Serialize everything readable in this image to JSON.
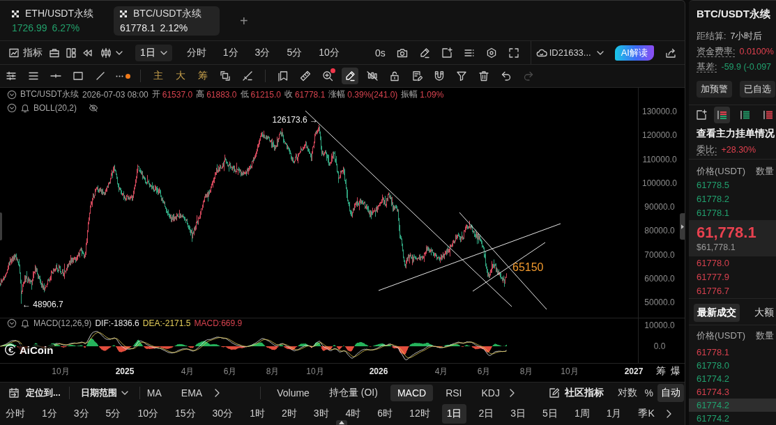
{
  "tabs": [
    {
      "symbol": "ETH/USDT永续",
      "price": "1726.99",
      "change": "6.27%",
      "selected": false
    },
    {
      "symbol": "BTC/USDT永续",
      "price": "61778.1",
      "change": "2.12%",
      "selected": true
    }
  ],
  "new_tab": "+",
  "toolbar": {
    "indicators": "指标",
    "interval": "1日",
    "quick_intervals": [
      "分时",
      "1分",
      "3分",
      "5分",
      "10分"
    ],
    "countdown": "0s",
    "account": "ID21633...",
    "ai_button": "AI解读"
  },
  "drawing_toolbar": {
    "modes": [
      "主",
      "大",
      "筹"
    ],
    "more_dot": true,
    "zoom_dot": true,
    "pen_selected": true,
    "redo_disabled": true
  },
  "chart": {
    "symbol": "BTC/USDT永续",
    "time": "2026-07-03 08:00",
    "quote": [
      {
        "label": "开",
        "value": "61537.0"
      },
      {
        "label": "高",
        "value": "61883.0"
      },
      {
        "label": "低",
        "value": "61215.0"
      },
      {
        "label": "收",
        "value": "61778.1"
      },
      {
        "label": "涨幅",
        "value": "0.39%(241.0)"
      },
      {
        "label": "振幅",
        "value": "1.09%"
      }
    ],
    "overlay": "BOLL(20,2)",
    "price_axis": [
      "130000.0",
      "120000.0",
      "110000.0",
      "100000.0",
      "90000.0",
      "80000.0",
      "70000.0",
      "60000.0",
      "50000.0"
    ],
    "high_marker": "126173.6 →",
    "low_marker": "← 48906.7",
    "level_label": "65150",
    "macd": {
      "name": "MACD(12,26,9)",
      "dif": "DIF:-1836.6",
      "dea": "DEA:-2171.5",
      "value": "MACD:669.9",
      "axis": [
        "10000.0",
        "0.0"
      ]
    },
    "logo": "AiCoin",
    "time_axis": [
      {
        "label": "10月",
        "kind": "month"
      },
      {
        "label": "2025",
        "kind": "year"
      },
      {
        "label": "4月",
        "kind": "month"
      },
      {
        "label": "6月",
        "kind": "month"
      },
      {
        "label": "8月",
        "kind": "month"
      },
      {
        "label": "10月",
        "kind": "month"
      },
      {
        "label": "2026",
        "kind": "year"
      },
      {
        "label": "4月",
        "kind": "month"
      },
      {
        "label": "6月",
        "kind": "month"
      },
      {
        "label": "8月",
        "kind": "month"
      },
      {
        "label": "10月",
        "kind": "month"
      },
      {
        "label": "2027",
        "kind": "year"
      }
    ],
    "axis_buttons": [
      "筹",
      "爆"
    ]
  },
  "indicator_bar": {
    "locate": "定位到...",
    "date_range": "日期范围",
    "main_indicators": [
      "MA",
      "EMA"
    ],
    "sub_indicators": [
      {
        "label": "Volume",
        "selected": false
      },
      {
        "label": "持仓量 (OI)",
        "selected": false
      },
      {
        "label": "MACD",
        "selected": true
      },
      {
        "label": "RSI",
        "selected": false
      },
      {
        "label": "KDJ",
        "selected": false
      }
    ],
    "community": "社区指标",
    "scale_options": [
      {
        "label": "对数",
        "selected": false
      },
      {
        "label": "%",
        "selected": false
      },
      {
        "label": "自动",
        "selected": true
      }
    ]
  },
  "periods": [
    {
      "label": "分时",
      "selected": false
    },
    {
      "label": "1分",
      "selected": false
    },
    {
      "label": "3分",
      "selected": false
    },
    {
      "label": "5分",
      "selected": false
    },
    {
      "label": "10分",
      "selected": false
    },
    {
      "label": "15分",
      "selected": false
    },
    {
      "label": "30分",
      "selected": false
    },
    {
      "label": "1时",
      "selected": false
    },
    {
      "label": "2时",
      "selected": false
    },
    {
      "label": "3时",
      "selected": false
    },
    {
      "label": "4时",
      "selected": false
    },
    {
      "label": "6时",
      "selected": false
    },
    {
      "label": "12时",
      "selected": false
    },
    {
      "label": "1日",
      "selected": true
    },
    {
      "label": "2日",
      "selected": false
    },
    {
      "label": "3日",
      "selected": false
    },
    {
      "label": "5日",
      "selected": false
    },
    {
      "label": "1周",
      "selected": false
    },
    {
      "label": "1月",
      "selected": false
    },
    {
      "label": "季K",
      "selected": false
    }
  ],
  "side_panel": {
    "symbol": "BTC/USDT永续",
    "stats": [
      {
        "label": "距结算:",
        "value": "7小时后",
        "color": "#cccccc",
        "tooltip": false
      },
      {
        "label": "资金费率:",
        "value": "0.0100%",
        "color": "#e0404e",
        "tooltip": true
      },
      {
        "label": "基差:",
        "value": "-59.9 (-0.097",
        "color": "#21a06e",
        "tooltip": true
      }
    ],
    "buttons": [
      "加预警",
      "已自选"
    ],
    "book_views": [
      {
        "kind": "both",
        "selected": true
      },
      {
        "kind": "bids",
        "selected": false
      },
      {
        "kind": "asks",
        "selected": false
      }
    ],
    "book_title": "查看主力挂单情况",
    "ratio": {
      "label": "委比:",
      "value": "+28.30%",
      "tooltip": true
    },
    "book_columns": [
      "价格(USDT)",
      "数量"
    ],
    "asks": [
      "61778.5",
      "61778.2",
      "61778.1"
    ],
    "last_price": "61,778.1",
    "last_price_usd": "$61,778.1",
    "bids": [
      "61778.0",
      "61777.9",
      "61776.7"
    ],
    "trade_tabs": [
      {
        "label": "最新成交",
        "selected": true
      },
      {
        "label": "大额",
        "selected": false
      }
    ],
    "trade_columns": [
      "价格(USDT)",
      "数量"
    ],
    "trades": [
      {
        "price": "61778.1",
        "color": "#d6404e",
        "highlighted": false
      },
      {
        "price": "61778.0",
        "color": "#21a06e",
        "highlighted": false
      },
      {
        "price": "61774.2",
        "color": "#21a06e",
        "highlighted": false
      },
      {
        "price": "61774.3",
        "color": "#d6404e",
        "highlighted": false
      },
      {
        "price": "61774.2",
        "color": "#21a06e",
        "highlighted": true
      },
      {
        "price": "61774.2",
        "color": "#21a06e",
        "highlighted": false
      }
    ]
  }
}
